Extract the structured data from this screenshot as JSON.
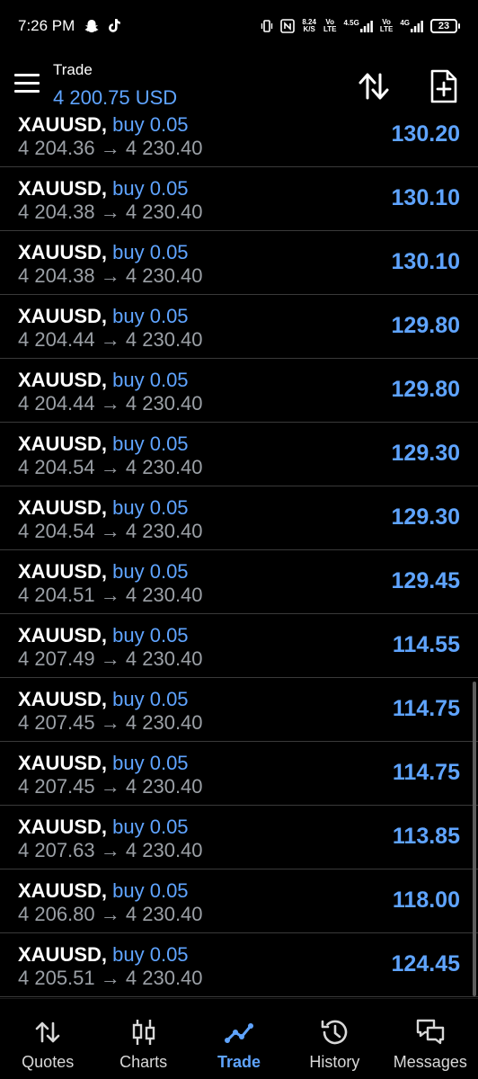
{
  "status_bar": {
    "time": "7:26 PM",
    "speed_value": "8.24",
    "speed_unit": "K/S",
    "sim1_tag_top": "Vo",
    "sim1_tag_bottom": "LTE",
    "network1": "4.5G",
    "sim2_tag_top": "Vo",
    "sim2_tag_bottom": "LTE",
    "network2": "4G",
    "battery": "23"
  },
  "header": {
    "title": "Trade",
    "balance": "4 200.75 USD"
  },
  "positions": [
    {
      "symbol": "XAUUSD,",
      "side": "buy 0.05",
      "open_price": "4 204.36",
      "arrow": "→",
      "current_price": "4 230.40",
      "profit": "130.20"
    },
    {
      "symbol": "XAUUSD,",
      "side": "buy 0.05",
      "open_price": "4 204.38",
      "arrow": "→",
      "current_price": "4 230.40",
      "profit": "130.10"
    },
    {
      "symbol": "XAUUSD,",
      "side": "buy 0.05",
      "open_price": "4 204.38",
      "arrow": "→",
      "current_price": "4 230.40",
      "profit": "130.10"
    },
    {
      "symbol": "XAUUSD,",
      "side": "buy 0.05",
      "open_price": "4 204.44",
      "arrow": "→",
      "current_price": "4 230.40",
      "profit": "129.80"
    },
    {
      "symbol": "XAUUSD,",
      "side": "buy 0.05",
      "open_price": "4 204.44",
      "arrow": "→",
      "current_price": "4 230.40",
      "profit": "129.80"
    },
    {
      "symbol": "XAUUSD,",
      "side": "buy 0.05",
      "open_price": "4 204.54",
      "arrow": "→",
      "current_price": "4 230.40",
      "profit": "129.30"
    },
    {
      "symbol": "XAUUSD,",
      "side": "buy 0.05",
      "open_price": "4 204.54",
      "arrow": "→",
      "current_price": "4 230.40",
      "profit": "129.30"
    },
    {
      "symbol": "XAUUSD,",
      "side": "buy 0.05",
      "open_price": "4 204.51",
      "arrow": "→",
      "current_price": "4 230.40",
      "profit": "129.45"
    },
    {
      "symbol": "XAUUSD,",
      "side": "buy 0.05",
      "open_price": "4 207.49",
      "arrow": "→",
      "current_price": "4 230.40",
      "profit": "114.55"
    },
    {
      "symbol": "XAUUSD,",
      "side": "buy 0.05",
      "open_price": "4 207.45",
      "arrow": "→",
      "current_price": "4 230.40",
      "profit": "114.75"
    },
    {
      "symbol": "XAUUSD,",
      "side": "buy 0.05",
      "open_price": "4 207.45",
      "arrow": "→",
      "current_price": "4 230.40",
      "profit": "114.75"
    },
    {
      "symbol": "XAUUSD,",
      "side": "buy 0.05",
      "open_price": "4 207.63",
      "arrow": "→",
      "current_price": "4 230.40",
      "profit": "113.85"
    },
    {
      "symbol": "XAUUSD,",
      "side": "buy 0.05",
      "open_price": "4 206.80",
      "arrow": "→",
      "current_price": "4 230.40",
      "profit": "118.00"
    },
    {
      "symbol": "XAUUSD,",
      "side": "buy 0.05",
      "open_price": "4 205.51",
      "arrow": "→",
      "current_price": "4 230.40",
      "profit": "124.45"
    }
  ],
  "nav": {
    "items": [
      {
        "label": "Quotes",
        "icon": "quotes-arrows-icon"
      },
      {
        "label": "Charts",
        "icon": "candlestick-icon"
      },
      {
        "label": "Trade",
        "icon": "trend-line-icon",
        "active": true
      },
      {
        "label": "History",
        "icon": "history-clock-icon"
      },
      {
        "label": "Messages",
        "icon": "chat-bubbles-icon"
      }
    ]
  },
  "colors": {
    "accent": "#5fa4ff",
    "background": "#000000",
    "divider": "#3a3a3a",
    "muted_text": "#9ba0a6"
  }
}
